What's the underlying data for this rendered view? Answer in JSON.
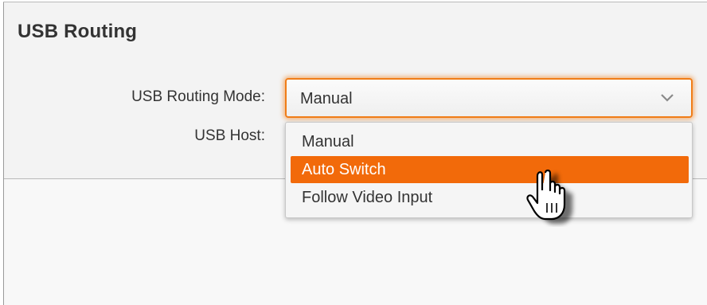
{
  "panel": {
    "title": "USB Routing"
  },
  "form": {
    "mode_label": "USB Routing Mode:",
    "host_label": "USB Host:",
    "mode_select": {
      "selected": "Manual",
      "highlighted": "Auto Switch",
      "options": [
        "Manual",
        "Auto Switch",
        "Follow Video Input"
      ]
    }
  },
  "colors": {
    "accent": "#f07d18",
    "highlight": "#f26a0a"
  },
  "icons": {
    "dropdown": "chevron-down-icon",
    "pointer": "hand-cursor-icon"
  }
}
